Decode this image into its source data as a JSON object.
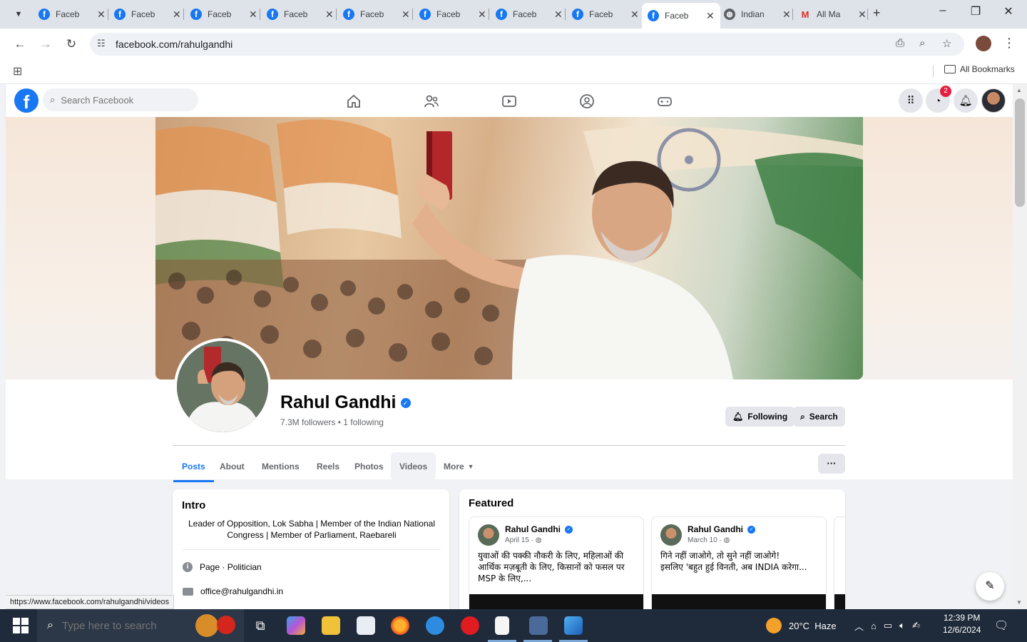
{
  "browser": {
    "tabs": [
      {
        "label": "Faceb",
        "icon": "facebook-icon"
      },
      {
        "label": "Faceb",
        "icon": "facebook-icon"
      },
      {
        "label": "Faceb",
        "icon": "facebook-icon"
      },
      {
        "label": "Faceb",
        "icon": "facebook-icon"
      },
      {
        "label": "Faceb",
        "icon": "facebook-icon"
      },
      {
        "label": "Faceb",
        "icon": "facebook-icon"
      },
      {
        "label": "Faceb",
        "icon": "facebook-icon"
      },
      {
        "label": "Faceb",
        "icon": "facebook-icon"
      },
      {
        "label": "Faceb",
        "icon": "facebook-icon"
      },
      {
        "label": "Indian",
        "icon": "globe-icon"
      },
      {
        "label": "All Ma",
        "icon": "gmail-icon"
      }
    ],
    "active_tab_index": 8,
    "url": "facebook.com/rahulgandhi",
    "bookmarks_folder": "All Bookmarks",
    "status_url": "https://www.facebook.com/rahulgandhi/videos"
  },
  "facebook": {
    "search_placeholder": "Search Facebook",
    "messenger_badge": "2",
    "brand_color": "#1877f2"
  },
  "profile": {
    "name": "Rahul Gandhi",
    "stats": "7.3M followers • 1 following",
    "following_label": "Following",
    "search_label": "Search",
    "tabs": [
      "Posts",
      "About",
      "Mentions",
      "Reels",
      "Photos",
      "Videos",
      "More"
    ],
    "active_tab": "Posts",
    "more_dots": "···"
  },
  "intro": {
    "title": "Intro",
    "bio": "Leader of Opposition, Lok Sabha | Member of the Indian National Congress | Member of Parliament, Raebareli",
    "category": "Page · Politician",
    "email": "office@rahulgandhi.in"
  },
  "featured": {
    "title": "Featured",
    "posts": [
      {
        "author": "Rahul Gandhi",
        "date": "April 15",
        "text": "युवाओं की पक्की नौकरी के लिए, महिलाओं की आर्थिक मज़बूती के लिए, किसानों को फसल पर MSP के लिए,..."
      },
      {
        "author": "Rahul Gandhi",
        "date": "March 10",
        "text": "गिने नहीं जाओगे, तो सुने नहीं जाओगे!\nइसलिए 'बहुत हुई विनती, अब INDIA करेगा..."
      }
    ]
  },
  "taskbar": {
    "search_placeholder": "Type here to search",
    "weather": "20°C  Haze",
    "time": "12:39 PM",
    "date": "12/6/2024"
  }
}
